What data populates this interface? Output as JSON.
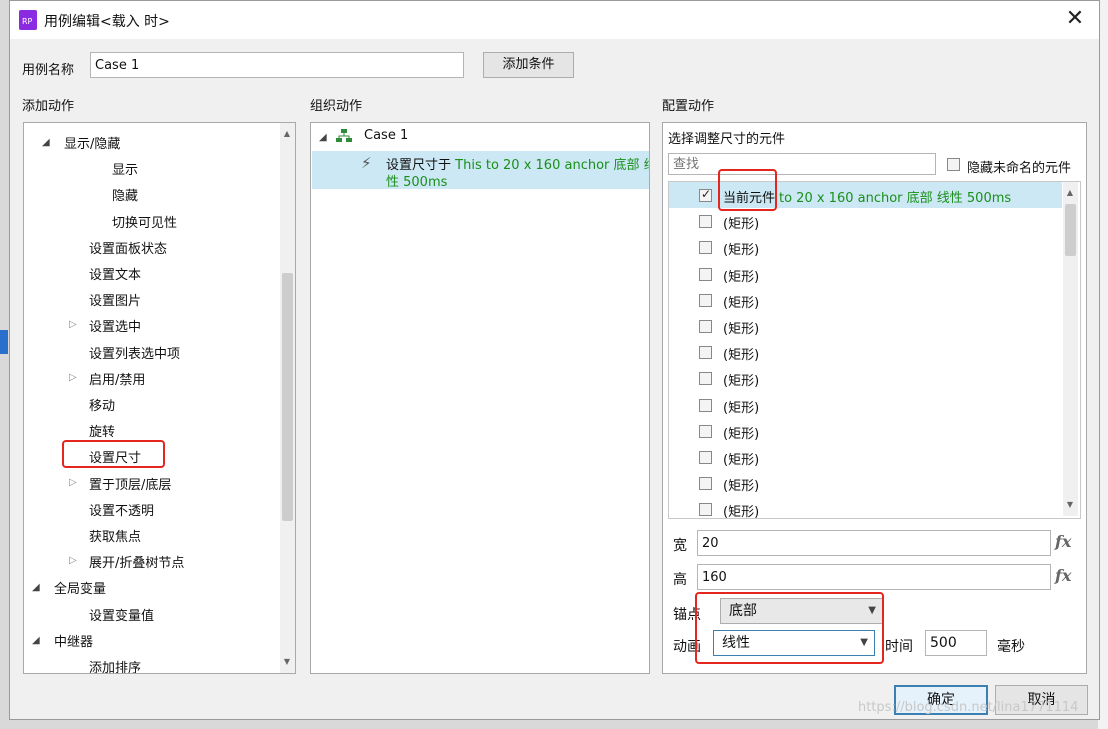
{
  "dialog": {
    "title": "用例编辑<载入 时>",
    "close_label": "✕"
  },
  "case_name": {
    "label": "用例名称",
    "value": "Case 1",
    "add_condition": "添加条件"
  },
  "add_action": {
    "header": "添加动作",
    "items": [
      {
        "label": "显示/隐藏",
        "expand": "down"
      },
      {
        "label": "显示"
      },
      {
        "label": "隐藏"
      },
      {
        "label": "切换可见性"
      },
      {
        "label": "设置面板状态"
      },
      {
        "label": "设置文本"
      },
      {
        "label": "设置图片"
      },
      {
        "label": "设置选中",
        "expand": "right"
      },
      {
        "label": "设置列表选中项"
      },
      {
        "label": "启用/禁用",
        "expand": "right"
      },
      {
        "label": "移动"
      },
      {
        "label": "旋转"
      },
      {
        "label": "设置尺寸"
      },
      {
        "label": "置于顶层/底层",
        "expand": "right"
      },
      {
        "label": "设置不透明"
      },
      {
        "label": "获取焦点"
      },
      {
        "label": "展开/折叠树节点",
        "expand": "right"
      },
      {
        "label": "全局变量",
        "expand": "down"
      },
      {
        "label": "设置变量值"
      },
      {
        "label": "中继器",
        "expand": "down"
      },
      {
        "label": "添加排序"
      }
    ]
  },
  "organize": {
    "header": "组织动作",
    "case_label": "Case 1",
    "action_prefix": "设置尺寸于",
    "action_detail_1": "This to 20 x 160 anchor 底部 线",
    "action_detail_2": "性 500ms"
  },
  "configure": {
    "header": "配置动作",
    "select_widget_label": "选择调整尺寸的元件",
    "search_placeholder": "查找",
    "hide_unnamed_label": "隐藏未命名的元件",
    "widgets": [
      {
        "name": "当前元件",
        "detail": "to 20 x 160 anchor 底部 线性 500ms",
        "checked": true
      },
      {
        "name": "(矩形)",
        "checked": false
      },
      {
        "name": "(矩形)",
        "checked": false
      },
      {
        "name": "(矩形)",
        "checked": false
      },
      {
        "name": "(矩形)",
        "checked": false
      },
      {
        "name": "(矩形)",
        "checked": false
      },
      {
        "name": "(矩形)",
        "checked": false
      },
      {
        "name": "(矩形)",
        "checked": false
      },
      {
        "name": "(矩形)",
        "checked": false
      },
      {
        "name": "(矩形)",
        "checked": false
      },
      {
        "name": "(矩形)",
        "checked": false
      },
      {
        "name": "(矩形)",
        "checked": false
      },
      {
        "name": "(矩形)",
        "checked": false
      }
    ],
    "width_label": "宽",
    "width_value": "20",
    "height_label": "高",
    "height_value": "160",
    "fx_label": "fx",
    "anchor_label": "锚点",
    "anchor_value": "底部",
    "animation_label": "动画",
    "animation_value": "线性",
    "time_label": "时间",
    "time_value": "500",
    "ms_label": "毫秒"
  },
  "footer": {
    "ok_label": "确定",
    "cancel_label": "取消"
  },
  "watermark": "https://blog.csdn.net/lina1771114"
}
